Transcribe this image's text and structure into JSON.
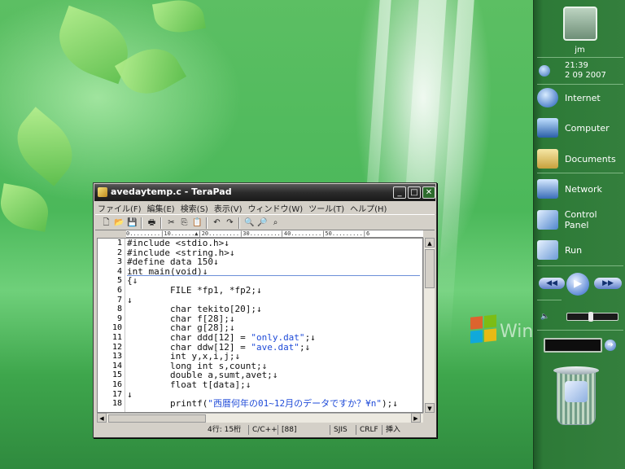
{
  "desktop": {
    "watermark_text": "Windows"
  },
  "sidebar": {
    "user_name": "jm",
    "clock_time": "21:39",
    "clock_date": "2 09 2007",
    "items": [
      {
        "label": "Internet",
        "icon": "internet-icon"
      },
      {
        "label": "Computer",
        "icon": "computer-icon"
      },
      {
        "label": "Documents",
        "icon": "documents-icon"
      },
      {
        "label": "Network",
        "icon": "network-icon"
      },
      {
        "label": "Control Panel",
        "icon": "control-panel-icon"
      },
      {
        "label": "Run",
        "icon": "run-icon"
      }
    ],
    "volume_level": 0.45
  },
  "terapad": {
    "title": "avedaytemp.c - TeraPad",
    "menus": [
      "ファイル(F)",
      "編集(E)",
      "検索(S)",
      "表示(V)",
      "ウィンドウ(W)",
      "ツール(T)",
      "ヘルプ(H)"
    ],
    "ruler": "0.........|10.......▲|20.........|30.........|40.........|50.........|6",
    "line_numbers": [
      "1",
      "2",
      "3",
      "4",
      "5",
      "6",
      "7",
      "8",
      "9",
      "10",
      "11",
      "12",
      "13",
      "14",
      "15",
      "16",
      "17",
      "18"
    ],
    "code_lines": [
      "#include <stdio.h>↓",
      "#include <string.h>↓",
      "#define data 150↓",
      "int main(void)↓",
      "{↓",
      "        FILE *fp1, *fp2;↓",
      "↓",
      "        char tekito[20];↓",
      "        char f[28];↓",
      "        char g[28];↓",
      "        char ddd[12] = \"only.dat\";↓",
      "        char ddw[12] = \"ave.dat\";↓",
      "        int y,x,i,j;↓",
      "        long int s,count;↓",
      "        double a,sumt,avet;↓",
      "        float t[data];↓",
      "↓",
      "        printf(\"西暦何年の01~12月のデータですか？¥n\");↓"
    ],
    "status": {
      "position": "4行: 15桁",
      "language": "C/C++",
      "code": "[88]",
      "encoding": "SJIS",
      "line_ending": "CRLF",
      "mode": "挿入"
    }
  },
  "colors": {
    "string_literal": "#1f4bd8",
    "titlebar": "#2b2b2b",
    "sidebar": "#2d7a37"
  }
}
